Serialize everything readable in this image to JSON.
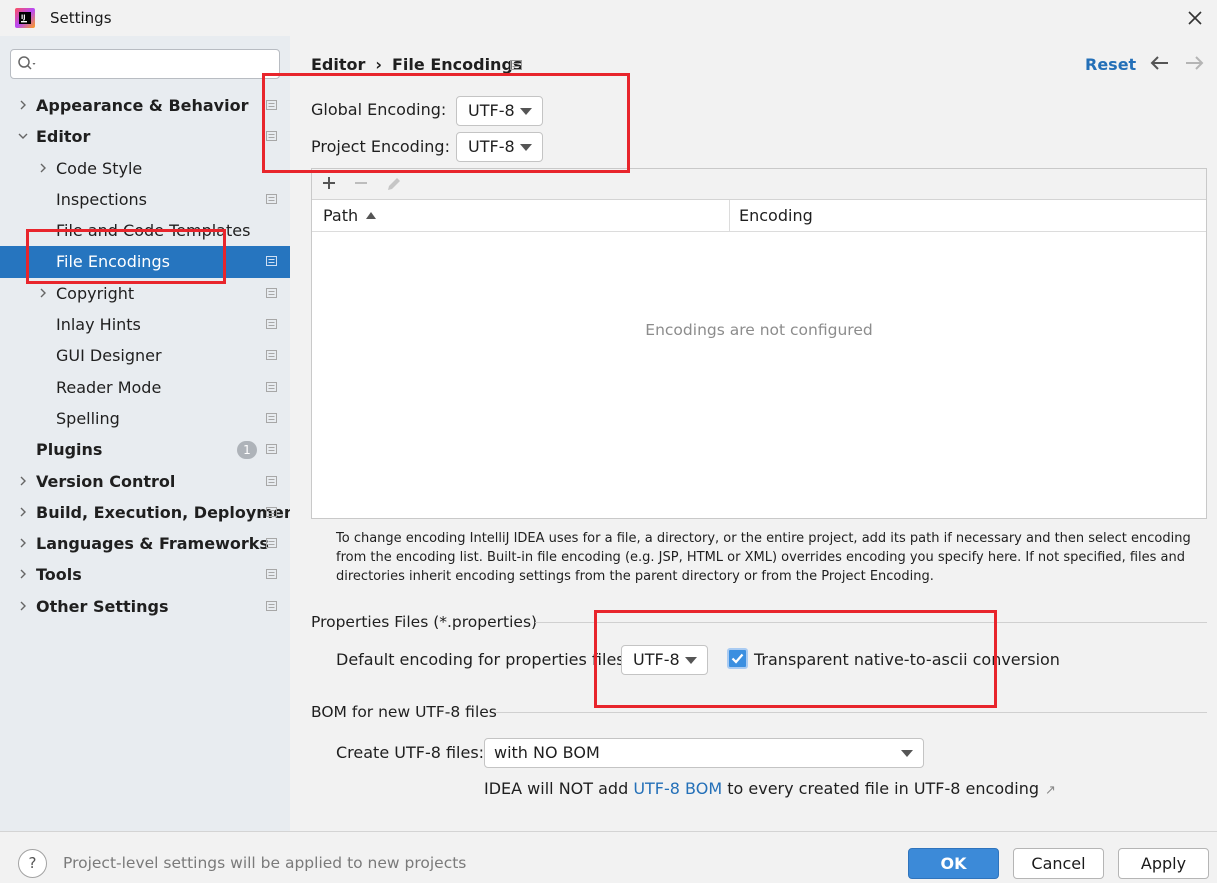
{
  "window": {
    "title": "Settings"
  },
  "search": {
    "placeholder": ""
  },
  "sidebar": {
    "items": [
      {
        "label": "Appearance & Behavior",
        "level": 0,
        "bold": true,
        "expandable": true,
        "expanded": false,
        "page_icon": true
      },
      {
        "label": "Editor",
        "level": 0,
        "bold": true,
        "expandable": true,
        "expanded": true,
        "page_icon": true
      },
      {
        "label": "Code Style",
        "level": 1,
        "bold": false,
        "expandable": true,
        "expanded": false,
        "page_icon": false
      },
      {
        "label": "Inspections",
        "level": 1,
        "bold": false,
        "expandable": false,
        "page_icon": true
      },
      {
        "label": "File and Code Templates",
        "level": 1,
        "bold": false,
        "expandable": false,
        "page_icon": false
      },
      {
        "label": "File Encodings",
        "level": 1,
        "bold": false,
        "expandable": false,
        "page_icon": true,
        "selected": true
      },
      {
        "label": "Copyright",
        "level": 1,
        "bold": false,
        "expandable": true,
        "expanded": false,
        "page_icon": true
      },
      {
        "label": "Inlay Hints",
        "level": 1,
        "bold": false,
        "expandable": false,
        "page_icon": true
      },
      {
        "label": "GUI Designer",
        "level": 1,
        "bold": false,
        "expandable": false,
        "page_icon": true
      },
      {
        "label": "Reader Mode",
        "level": 1,
        "bold": false,
        "expandable": false,
        "page_icon": true
      },
      {
        "label": "Spelling",
        "level": 1,
        "bold": false,
        "expandable": false,
        "page_icon": true
      },
      {
        "label": "Plugins",
        "level": 0,
        "bold": true,
        "expandable": false,
        "page_icon": true,
        "badge": "1"
      },
      {
        "label": "Version Control",
        "level": 0,
        "bold": true,
        "expandable": true,
        "expanded": false,
        "page_icon": true
      },
      {
        "label": "Build, Execution, Deployment",
        "level": 0,
        "bold": true,
        "expandable": true,
        "expanded": false,
        "page_icon": true
      },
      {
        "label": "Languages & Frameworks",
        "level": 0,
        "bold": true,
        "expandable": true,
        "expanded": false,
        "page_icon": true
      },
      {
        "label": "Tools",
        "level": 0,
        "bold": true,
        "expandable": true,
        "expanded": false,
        "page_icon": true
      },
      {
        "label": "Other Settings",
        "level": 0,
        "bold": true,
        "expandable": true,
        "expanded": false,
        "page_icon": true
      }
    ]
  },
  "header": {
    "breadcrumb": [
      "Editor",
      "File Encodings"
    ],
    "separator": "›",
    "reset_label": "Reset"
  },
  "encodings": {
    "global_label": "Global Encoding:",
    "global_value": "UTF-8",
    "project_label": "Project Encoding:",
    "project_value": "UTF-8"
  },
  "table": {
    "columns": [
      "Path",
      "Encoding"
    ],
    "empty_text": "Encodings are not configured"
  },
  "help_text": "To change encoding IntelliJ IDEA uses for a file, a directory, or the entire project, add its path if necessary and then select encoding from the encoding list. Built-in file encoding (e.g. JSP, HTML or XML) overrides encoding you specify here. If not specified, files and directories inherit encoding settings from the parent directory or from the Project Encoding.",
  "properties": {
    "section_title": "Properties Files (*.properties)",
    "default_label": "Default encoding for properties files:",
    "default_value": "UTF-8",
    "transparent_label": "Transparent native-to-ascii conversion",
    "transparent_checked": true
  },
  "bom": {
    "section_title": "BOM for new UTF-8 files",
    "create_label": "Create UTF-8 files:",
    "create_value": "with NO BOM",
    "note_before": "IDEA will NOT add ",
    "note_link": "UTF-8 BOM",
    "note_after": " to every created file in UTF-8 encoding"
  },
  "footer": {
    "note": "Project-level settings will be applied to new projects",
    "help_label": "?",
    "ok_label": "OK",
    "cancel_label": "Cancel",
    "apply_label": "Apply"
  },
  "colors": {
    "selection": "#2675bf",
    "link": "#2470b8",
    "highlight_box": "#e8252c",
    "primary_button": "#3c8ad8"
  }
}
